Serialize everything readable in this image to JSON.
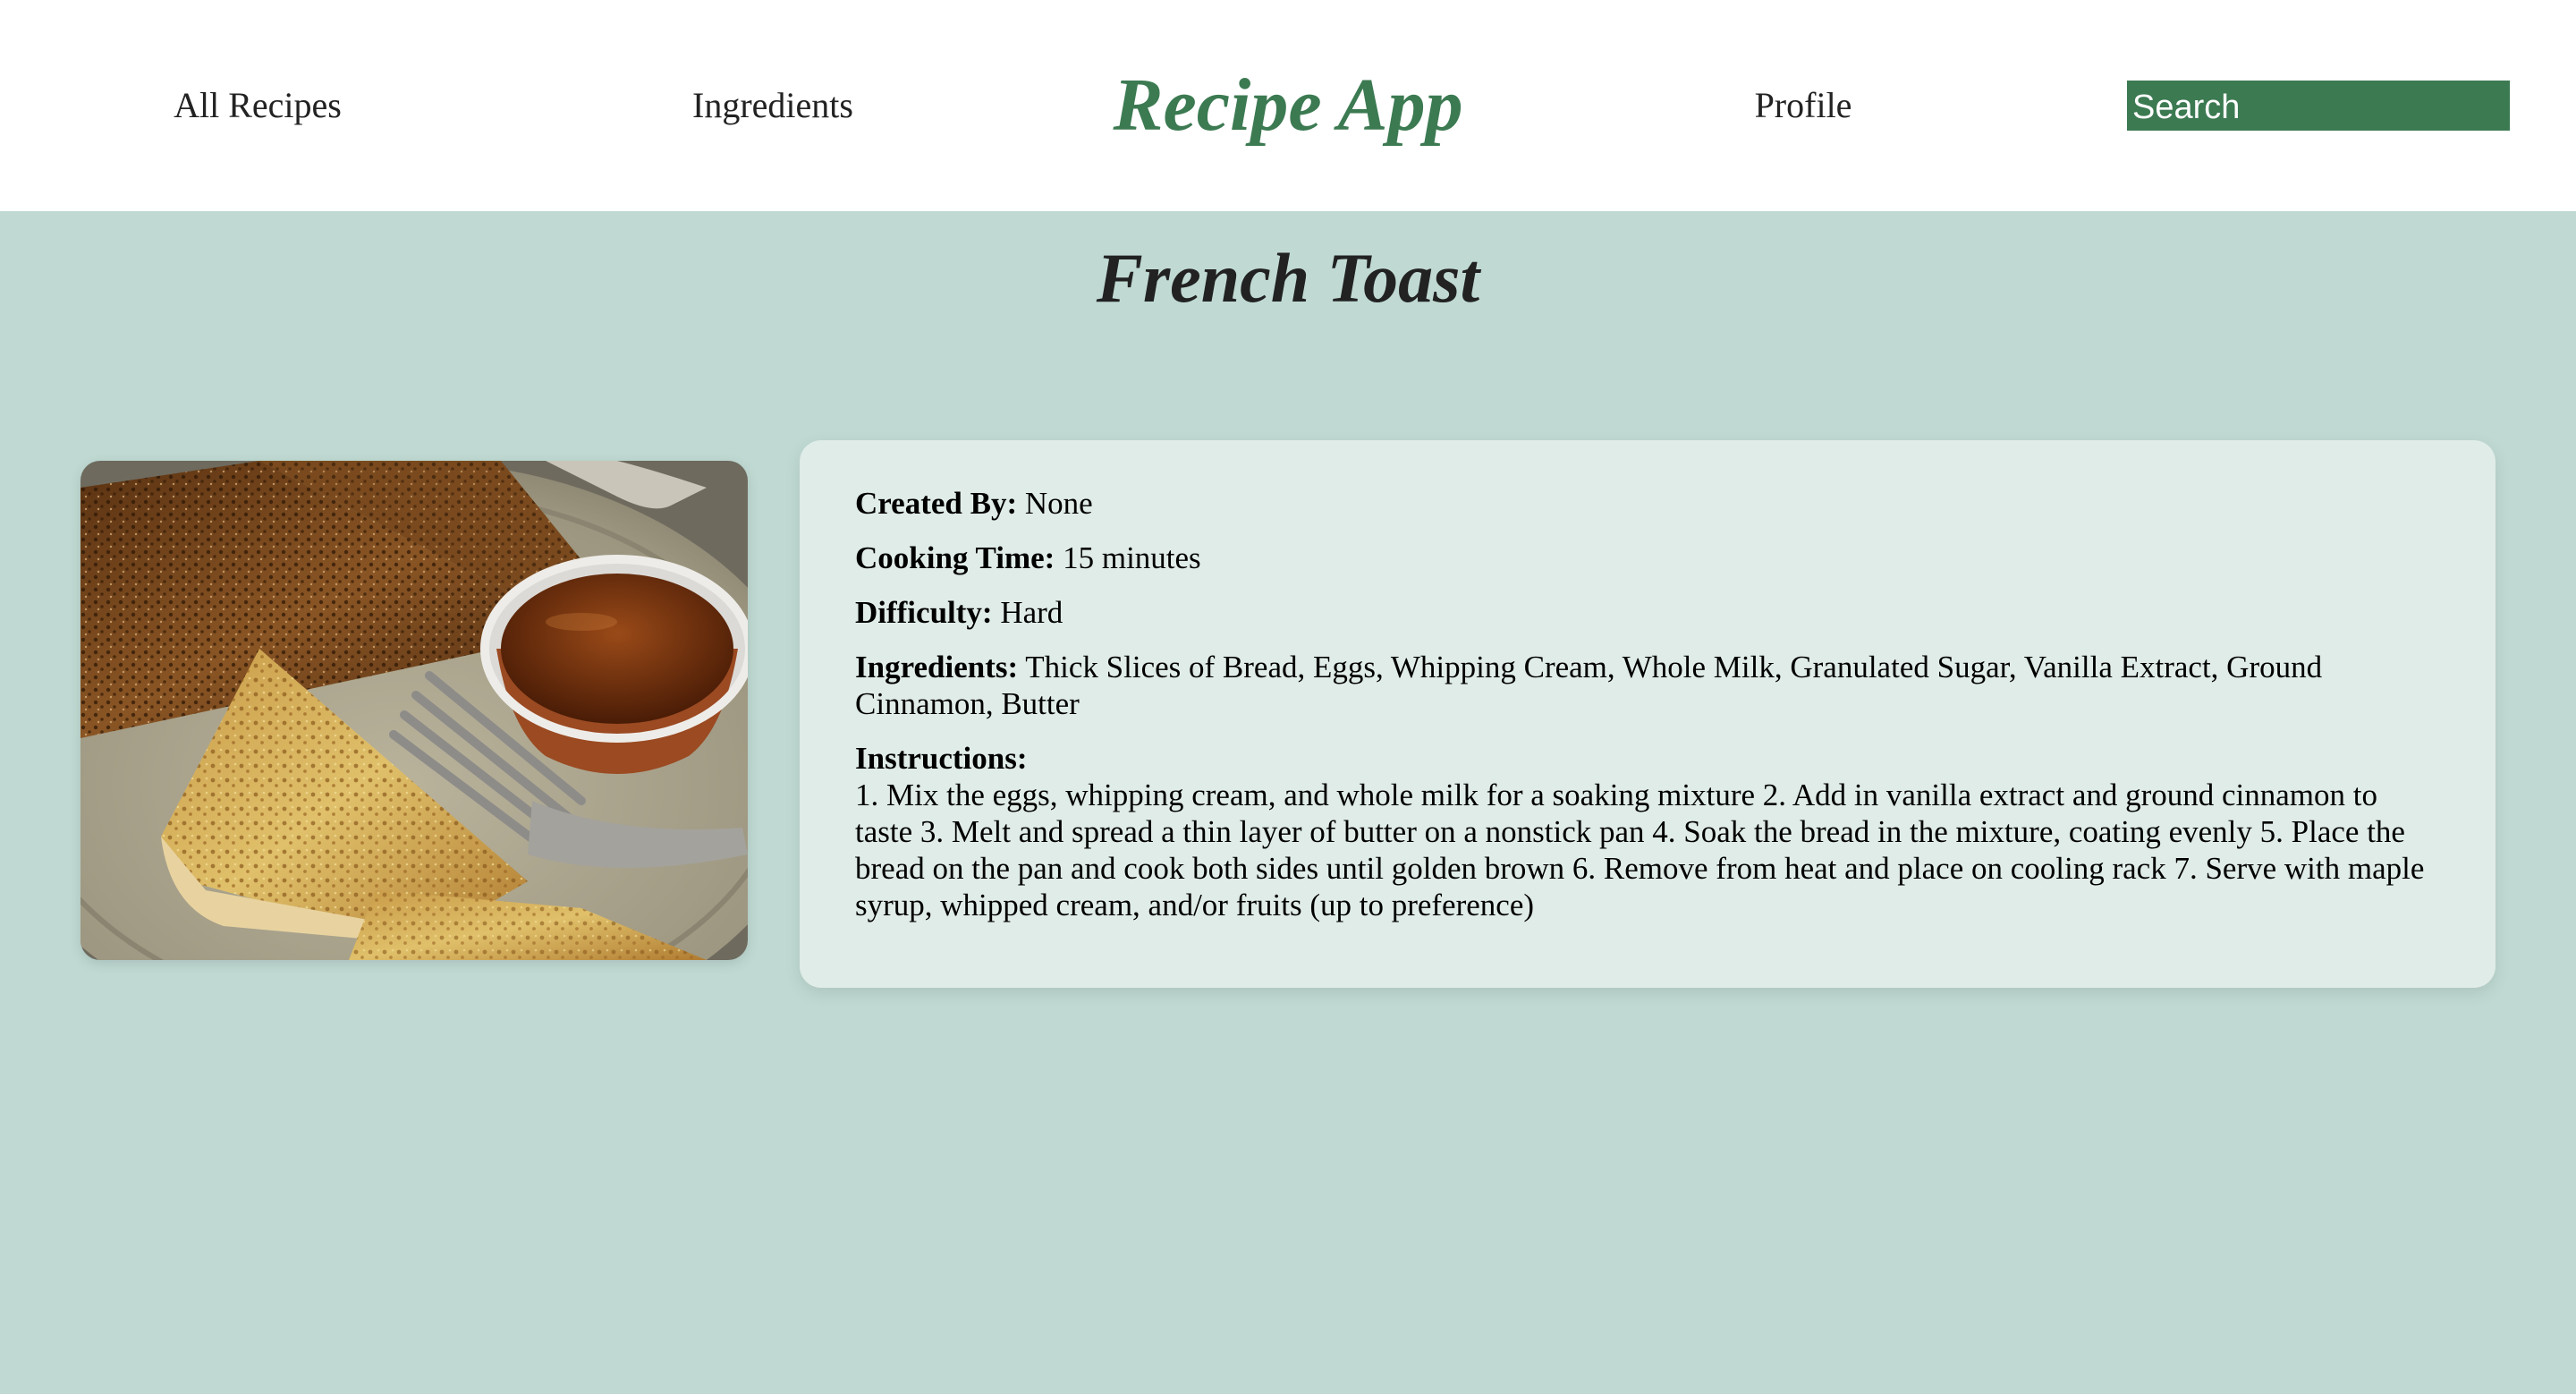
{
  "nav": {
    "all_recipes": "All Recipes",
    "ingredients": "Ingredients",
    "brand": "Recipe App",
    "profile": "Profile",
    "search_placeholder": "Search"
  },
  "recipe": {
    "title": "French Toast",
    "created_by_label": "Created By:",
    "created_by": "None",
    "cooking_time_label": "Cooking Time:",
    "cooking_time": "15 minutes",
    "difficulty_label": "Difficulty:",
    "difficulty": "Hard",
    "ingredients_label": "Ingredients:",
    "ingredients": "Thick Slices of Bread, Eggs, Whipping Cream, Whole Milk, Granulated Sugar, Vanilla Extract, Ground Cinnamon, Butter",
    "instructions_label": "Instructions:",
    "instructions": "1. Mix the eggs, whipping cream, and whole milk for a soaking mixture 2. Add in vanilla extract and ground cinnamon to taste 3. Melt and spread a thin layer of butter on a nonstick pan 4. Soak the bread in the mixture, coating evenly 5. Place the bread on the pan and cook both sides until golden brown 6. Remove from heat and place on cooling rack 7. Serve with maple syrup, whipped cream, and/or fruits (up to preference)"
  },
  "colors": {
    "background": "#c0dad3",
    "accent": "#3c7a52",
    "card": "#e0ece8",
    "header": "#ffffff"
  }
}
